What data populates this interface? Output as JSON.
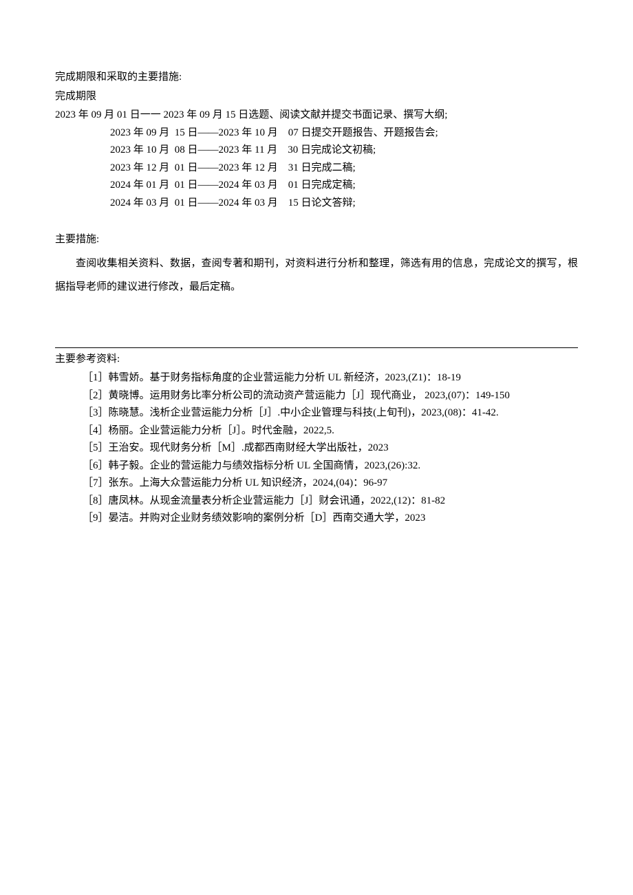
{
  "section1": {
    "title": "完成期限和采取的主要措施:",
    "deadline_label": "完成期限",
    "schedule": [
      "2023 年 09 月 01 日一一 2023 年 09 月 15 日选题、阅读文献并提交书面记录、撰写大纲;",
      "2023 年 09 月  15 日——2023 年 10 月    07 日提交开题报告、开题报告会;",
      "2023 年 10 月  08 日——2023 年 11 月    30 日完成论文初稿;",
      "2023 年 12 月  01 日——2023 年 12 月    31 日完成二稿;",
      "2024 年 01 月  01 日——2024 年 03 月    01 日完成定稿;",
      "2024 年 03 月  01 日——2024 年 03 月    15 日论文答辩;"
    ]
  },
  "section2": {
    "title": "主要措施:",
    "body": "查阅收集相关资料、数据，查阅专著和期刊，对资料进行分析和整理，筛选有用的信息，完成论文的撰写，根据指导老师的建议进行修改，最后定稿。"
  },
  "section3": {
    "title": "主要参考资料:",
    "refs": [
      "［1］韩雪娇。基于财务指标角度的企业营运能力分析 UL 新经济，2023,(Z1)：18-19",
      "［2］黄晓博。运用财务比率分析公司的流动资产营运能力［J］现代商业， 2023,(07)：149-150",
      "［3］陈晓慧。浅析企业营运能力分析［J］.中小企业管理与科技(上旬刊)，2023,(08)：41-42.",
      "［4］杨丽。企业营运能力分析［J］。时代金融，2022,5.",
      "［5］王治安。现代财务分析［M］.成都西南财经大学出版社，2023",
      "［6］韩子毅。企业的营运能力与绩效指标分析 UL 全国商情，2023,(26):32.",
      "［7］张东。上海大众营运能力分析 UL 知识经济，2024,(04)：96-97",
      "［8］唐凤林。从现金流量表分析企业营运能力［J］财会讯通，2022,(12)：81-82",
      "［9］晏洁。并购对企业财务绩效影响的案例分析［D］西南交通大学，2023"
    ]
  }
}
